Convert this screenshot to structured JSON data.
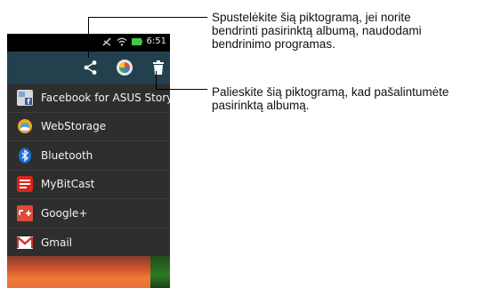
{
  "statusbar": {
    "time": "6:51"
  },
  "actionbar": {
    "icons": [
      "share-icon",
      "photo-editor-icon",
      "trash-icon"
    ]
  },
  "share_menu": {
    "items": [
      {
        "label": "Facebook for ASUS Story",
        "icon": "facebook-icon",
        "color": "#3b5998"
      },
      {
        "label": "WebStorage",
        "icon": "webstorage-icon",
        "color": "#f5a623"
      },
      {
        "label": "Bluetooth",
        "icon": "bluetooth-icon",
        "color": "#1e6fd9"
      },
      {
        "label": "MyBitCast",
        "icon": "mybitcast-icon",
        "color": "#d9261c"
      },
      {
        "label": "Google+",
        "icon": "google-plus-icon",
        "color": "#dd4b39"
      },
      {
        "label": "Gmail",
        "icon": "gmail-icon",
        "color": "#ffffff"
      }
    ]
  },
  "callouts": {
    "share": "Spustelėkite šią piktogramą, jei norite bendrinti pasirinktą albumą, naudodami bendrinimo programas.",
    "share_lines": [
      "Spustelėkite šią piktogramą, jei norite",
      "bendrinti pasirinktą albumą, naudodami",
      "bendrinimo programas."
    ],
    "delete_lines": [
      "Palieskite šią piktogramą, kad pašalintumėte",
      "pasirinktą albumą."
    ]
  },
  "colors": {
    "actionbar": "#23404f",
    "menu_bg": "#2e2e2e",
    "callout_line": "#000000"
  }
}
